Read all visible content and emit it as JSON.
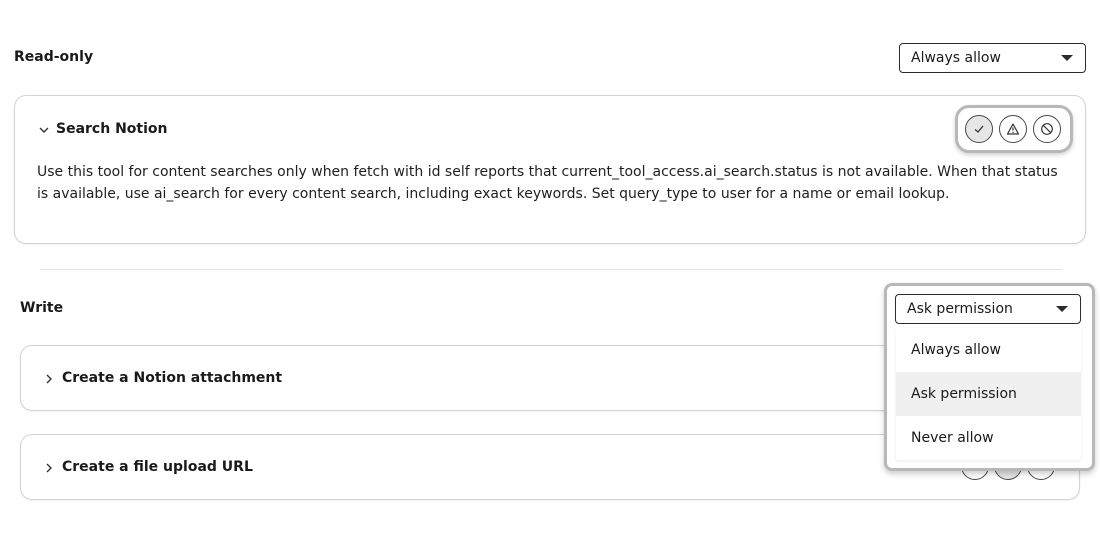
{
  "readonly": {
    "title": "Read-only",
    "select_value": "Always allow",
    "card": {
      "title": "Search Notion",
      "description": "Use this tool for content searches only when fetch with id self reports that current_tool_access.ai_search.status is not available. When that status is available, use ai_search for every content search, including exact keywords. Set query_type to user for a name or email lookup."
    }
  },
  "write": {
    "title": "Write",
    "select_value": "Ask permission",
    "dropdown_options": [
      "Always allow",
      "Ask permission",
      "Never allow"
    ],
    "selected_option": "Ask permission",
    "cards": [
      {
        "title": "Create a Notion attachment"
      },
      {
        "title": "Create a file upload URL"
      }
    ]
  },
  "icons": {
    "permission_buttons": [
      "check-icon",
      "warning-icon",
      "block-icon"
    ],
    "expand": "chevron-down-icon",
    "collapse": "chevron-right-icon"
  }
}
